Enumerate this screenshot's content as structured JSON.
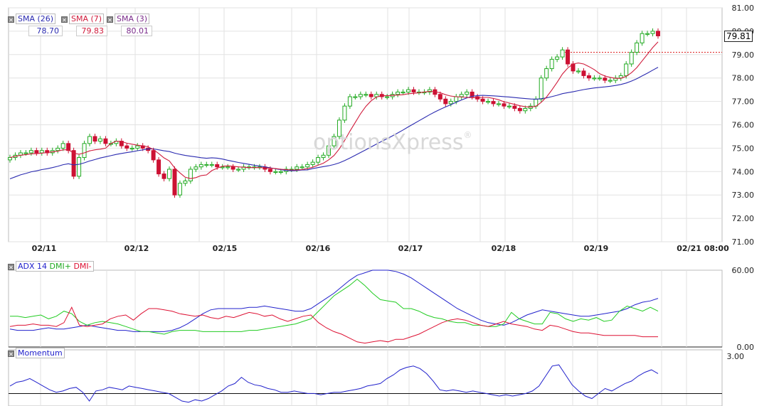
{
  "legend": {
    "sma26": {
      "label": "SMA (26)",
      "value": "78.70",
      "color": "#2b2bb0"
    },
    "sma7": {
      "label": "SMA (7)",
      "value": "79.83",
      "color": "#d01c3c"
    },
    "sma3": {
      "label": "SMA (3)",
      "value": "80.01",
      "color": "#7a2b8a"
    }
  },
  "last_price": "79.81",
  "watermark": "optionsXpress",
  "watermark_mark": "®",
  "colors": {
    "up": "#22aa22",
    "down": "#cc1133",
    "sma26": "#2b2bb0",
    "sma7": "#d01c3c",
    "adx": "#2222cc",
    "dmi_plus": "#22cc22",
    "dmi_minus": "#dd1133",
    "momentum": "#2222cc"
  },
  "chart_data": [
    {
      "type": "candlestick",
      "x_ticks": [
        "02/11",
        "02/12",
        "02/15",
        "02/16",
        "02/17",
        "02/18",
        "02/19",
        "02/21 08:00"
      ],
      "y_ticks": [
        "81.00",
        "80.00",
        "79.00",
        "78.00",
        "77.00",
        "76.00",
        "75.00",
        "74.00",
        "73.00",
        "72.00",
        "71.00"
      ],
      "ylim": [
        71,
        81
      ],
      "reference_line": 79.1,
      "series": [
        {
          "name": "Price",
          "close": [
            74.6,
            74.7,
            74.8,
            74.8,
            74.9,
            74.8,
            74.9,
            74.8,
            74.9,
            75.0,
            75.2,
            74.9,
            73.8,
            74.6,
            75.2,
            75.5,
            75.3,
            75.4,
            75.2,
            75.2,
            75.3,
            75.1,
            75.0,
            75.0,
            75.1,
            75.0,
            74.9,
            74.5,
            73.9,
            73.7,
            74.1,
            73.0,
            73.5,
            73.6,
            74.1,
            74.2,
            74.3,
            74.3,
            74.3,
            74.2,
            74.2,
            74.2,
            74.1,
            74.1,
            74.2,
            74.2,
            74.2,
            74.2,
            74.1,
            74.0,
            74.0,
            74.0,
            74.1,
            74.1,
            74.2,
            74.2,
            74.3,
            74.4,
            74.6,
            74.7,
            75.1,
            75.5,
            76.2,
            76.8,
            77.2,
            77.2,
            77.3,
            77.3,
            77.2,
            77.3,
            77.2,
            77.2,
            77.3,
            77.4,
            77.4,
            77.5,
            77.4,
            77.4,
            77.4,
            77.5,
            77.3,
            77.1,
            76.9,
            77.0,
            77.2,
            77.3,
            77.4,
            77.2,
            77.1,
            77.0,
            77.0,
            76.9,
            76.9,
            76.8,
            76.8,
            76.7,
            76.6,
            76.7,
            76.8,
            77.1,
            78.0,
            78.4,
            78.8,
            78.9,
            79.2,
            78.6,
            78.3,
            78.3,
            78.1,
            78.0,
            78.0,
            78.0,
            77.9,
            77.9,
            78.0,
            78.1,
            78.6,
            79.1,
            79.5,
            79.9,
            79.9,
            80.0,
            79.8
          ],
          "open": [
            74.5,
            74.6,
            74.7,
            74.8,
            74.8,
            74.9,
            74.8,
            74.9,
            74.8,
            74.9,
            75.0,
            75.2,
            74.9,
            73.8,
            74.6,
            75.2,
            75.5,
            75.3,
            75.4,
            75.2,
            75.2,
            75.3,
            75.1,
            75.0,
            75.0,
            75.1,
            75.0,
            74.9,
            74.5,
            73.9,
            73.7,
            74.1,
            73.0,
            73.5,
            73.6,
            74.1,
            74.2,
            74.3,
            74.3,
            74.3,
            74.2,
            74.2,
            74.2,
            74.1,
            74.1,
            74.2,
            74.2,
            74.2,
            74.2,
            74.1,
            74.0,
            74.0,
            74.0,
            74.1,
            74.1,
            74.2,
            74.2,
            74.3,
            74.4,
            74.6,
            74.7,
            75.1,
            75.5,
            76.2,
            76.8,
            77.2,
            77.2,
            77.3,
            77.3,
            77.2,
            77.3,
            77.2,
            77.2,
            77.3,
            77.4,
            77.4,
            77.5,
            77.4,
            77.4,
            77.4,
            77.5,
            77.3,
            77.1,
            76.9,
            77.0,
            77.2,
            77.3,
            77.4,
            77.2,
            77.1,
            77.0,
            77.0,
            76.9,
            76.9,
            76.8,
            76.8,
            76.7,
            76.6,
            76.7,
            76.8,
            77.1,
            78.0,
            78.4,
            78.8,
            78.9,
            79.2,
            78.6,
            78.3,
            78.3,
            78.1,
            78.0,
            78.0,
            78.0,
            77.9,
            77.9,
            78.0,
            78.1,
            78.6,
            79.1,
            79.5,
            79.9,
            79.9,
            80.0
          ]
        }
      ]
    },
    {
      "type": "line",
      "title": "ADX 14",
      "legend": [
        "ADX 14",
        "DMI+",
        "DMI-"
      ],
      "y_ticks": [
        "60.00",
        "0.00"
      ],
      "ylim": [
        0,
        60
      ],
      "series": [
        {
          "name": "ADX 14",
          "values": [
            14,
            13,
            13,
            13,
            14,
            15,
            14,
            14,
            15,
            16,
            17,
            16,
            15,
            14,
            13,
            13,
            12,
            12,
            12,
            12,
            12,
            13,
            15,
            18,
            22,
            26,
            29,
            30,
            30,
            30,
            30,
            31,
            31,
            32,
            31,
            30,
            29,
            28,
            28,
            30,
            34,
            38,
            42,
            47,
            52,
            56,
            58,
            60,
            60,
            60,
            59,
            57,
            54,
            50,
            46,
            42,
            38,
            34,
            30,
            27,
            24,
            21,
            19,
            18,
            17,
            19,
            22,
            25,
            27,
            29,
            28,
            27,
            26,
            25,
            24,
            24,
            25,
            26,
            27,
            28,
            30,
            33,
            35,
            36,
            38
          ]
        },
        {
          "name": "DMI+",
          "values": [
            24,
            24,
            23,
            24,
            25,
            22,
            24,
            28,
            26,
            20,
            17,
            19,
            20,
            19,
            18,
            16,
            14,
            12,
            12,
            11,
            10,
            12,
            13,
            13,
            13,
            12,
            12,
            12,
            12,
            12,
            12,
            13,
            13,
            14,
            15,
            16,
            17,
            18,
            20,
            22,
            28,
            34,
            40,
            44,
            48,
            53,
            48,
            42,
            37,
            36,
            35,
            30,
            30,
            28,
            25,
            23,
            22,
            20,
            19,
            19,
            17,
            17,
            16,
            16,
            18,
            27,
            22,
            20,
            18,
            18,
            27,
            26,
            22,
            20,
            22,
            21,
            23,
            20,
            21,
            28,
            32,
            30,
            28,
            31,
            28
          ]
        },
        {
          "name": "DMI-",
          "values": [
            16,
            17,
            17,
            18,
            17,
            17,
            16,
            19,
            31,
            17,
            16,
            17,
            18,
            22,
            24,
            25,
            21,
            26,
            30,
            30,
            29,
            28,
            26,
            25,
            24,
            25,
            23,
            22,
            24,
            23,
            25,
            27,
            26,
            24,
            25,
            22,
            20,
            22,
            24,
            25,
            19,
            15,
            12,
            10,
            7,
            4,
            3,
            4,
            5,
            4,
            6,
            6,
            8,
            10,
            13,
            16,
            19,
            21,
            22,
            21,
            19,
            17,
            16,
            18,
            20,
            18,
            17,
            16,
            14,
            13,
            17,
            16,
            14,
            12,
            11,
            11,
            10,
            9,
            9,
            9,
            9,
            9,
            8,
            8,
            8
          ]
        }
      ]
    },
    {
      "type": "line",
      "title": "Momentum",
      "legend": [
        "Momentum"
      ],
      "y_ticks": [
        "3.00"
      ],
      "ylim": [
        -1.0,
        3.5
      ],
      "reference_line": 0,
      "series": [
        {
          "name": "Momentum",
          "values": [
            0.6,
            0.9,
            1.0,
            1.2,
            0.9,
            0.6,
            0.3,
            0.1,
            0.2,
            0.4,
            0.5,
            0.1,
            -0.6,
            0.2,
            0.3,
            0.5,
            0.4,
            0.3,
            0.6,
            0.5,
            0.4,
            0.3,
            0.2,
            0.1,
            0.0,
            -0.3,
            -0.6,
            -0.7,
            -0.5,
            -0.6,
            -0.4,
            -0.1,
            0.2,
            0.6,
            0.8,
            1.3,
            0.9,
            0.7,
            0.6,
            0.4,
            0.3,
            0.1,
            0.1,
            0.2,
            0.1,
            0.0,
            0.0,
            -0.1,
            0.0,
            0.1,
            0.1,
            0.2,
            0.3,
            0.4,
            0.6,
            0.7,
            0.8,
            1.2,
            1.5,
            1.9,
            2.1,
            2.2,
            2.0,
            1.6,
            1.0,
            0.3,
            0.2,
            0.3,
            0.2,
            0.1,
            0.2,
            0.1,
            0.0,
            -0.1,
            -0.2,
            -0.1,
            -0.2,
            -0.1,
            0.0,
            0.2,
            0.6,
            1.4,
            2.2,
            2.3,
            1.5,
            0.7,
            0.2,
            -0.2,
            -0.4,
            0.0,
            0.4,
            0.2,
            0.5,
            0.8,
            1.0,
            1.4,
            1.7,
            1.9,
            1.6
          ]
        }
      ]
    }
  ]
}
